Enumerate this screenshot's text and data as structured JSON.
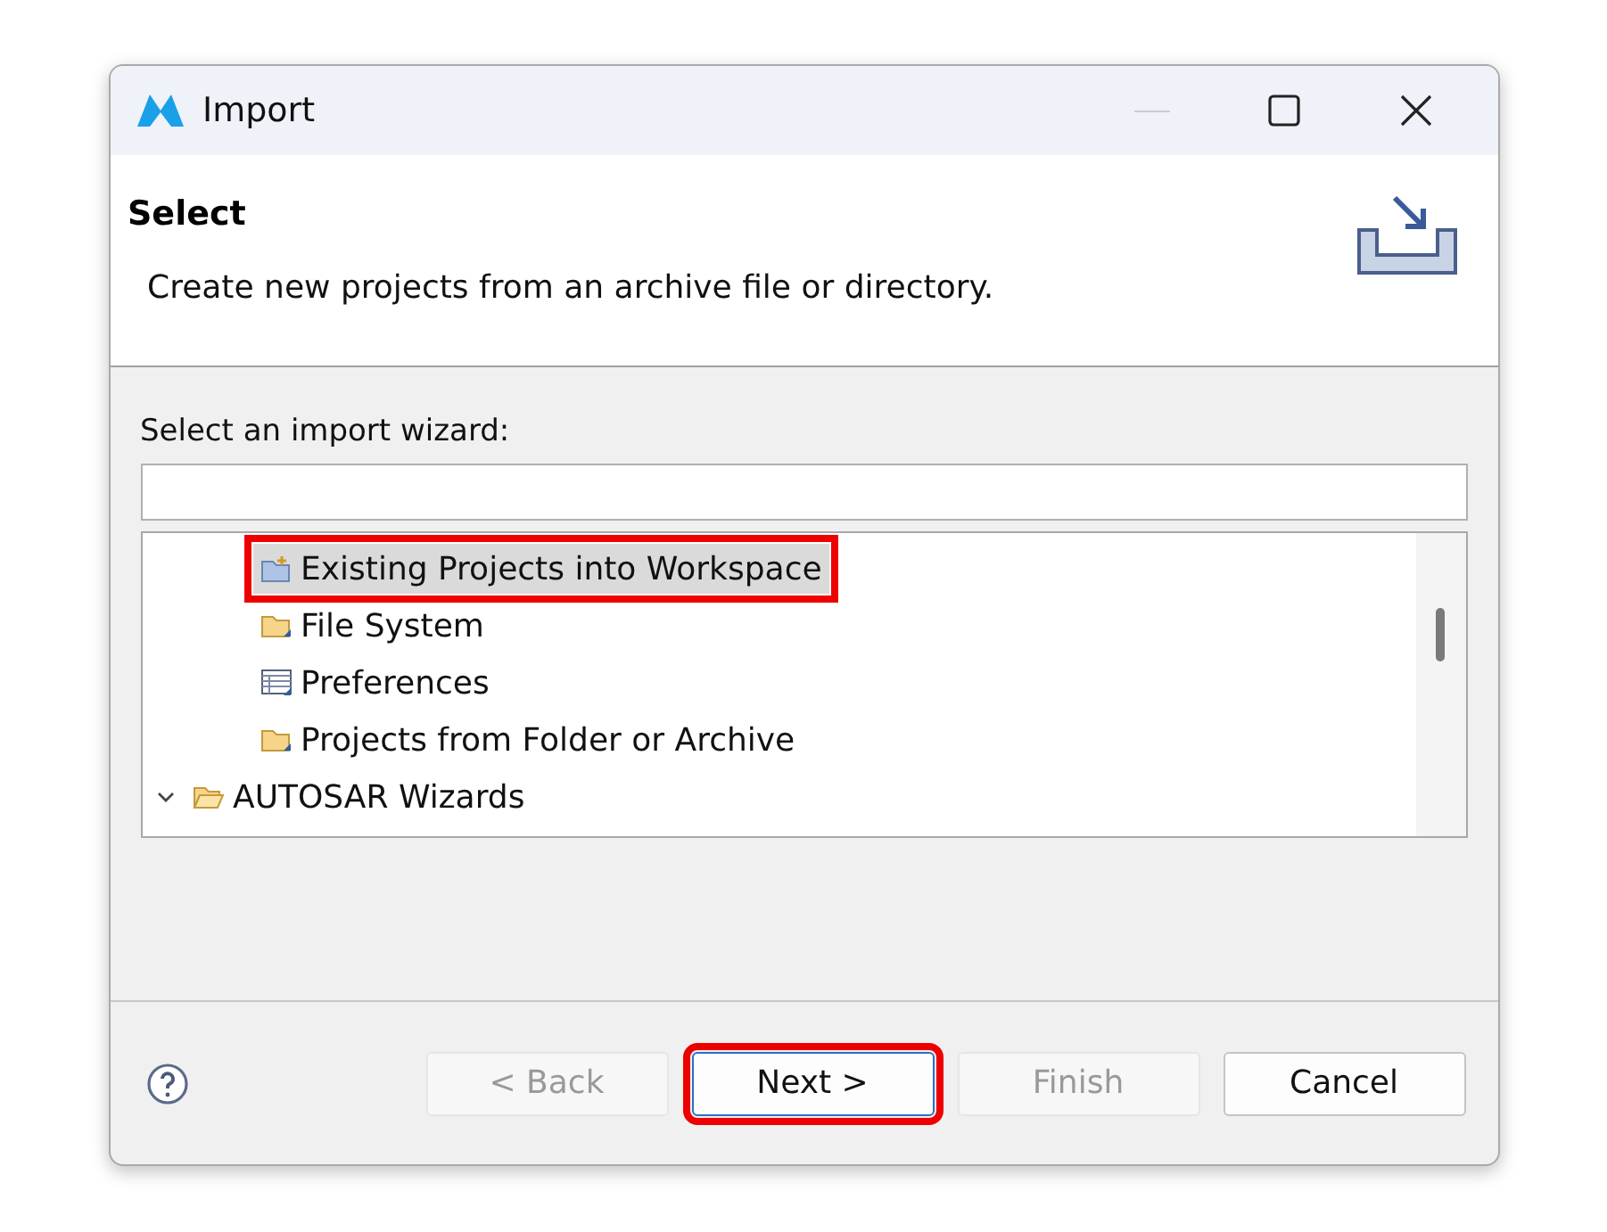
{
  "window": {
    "title": "Import"
  },
  "header": {
    "title": "Select",
    "description": "Create new projects from an archive file or directory."
  },
  "filter": {
    "label": "Select an import wizard:"
  },
  "tree": [
    {
      "children": [
        {
          "label": "Existing Projects into Workspace",
          "kind": "project",
          "selected": true,
          "highlighted": true
        },
        {
          "label": "File System",
          "kind": "folder",
          "selected": false,
          "highlighted": false
        },
        {
          "label": "Preferences",
          "kind": "table",
          "selected": false,
          "highlighted": false
        },
        {
          "label": "Projects from Folder or Archive",
          "kind": "folder",
          "selected": false,
          "highlighted": false
        }
      ]
    },
    {
      "label": "AUTOSAR Wizards",
      "kind": "open-folder",
      "expanded": true,
      "selected": false,
      "highlighted": false
    }
  ],
  "buttons": [
    {
      "label": "< Back",
      "disabled": true,
      "default": false,
      "highlighted": false
    },
    {
      "label": "Next >",
      "disabled": false,
      "default": true,
      "highlighted": true
    },
    {
      "label": "Finish",
      "disabled": true,
      "default": false,
      "highlighted": false
    },
    {
      "label": "Cancel",
      "disabled": false,
      "default": false,
      "highlighted": false
    }
  ]
}
